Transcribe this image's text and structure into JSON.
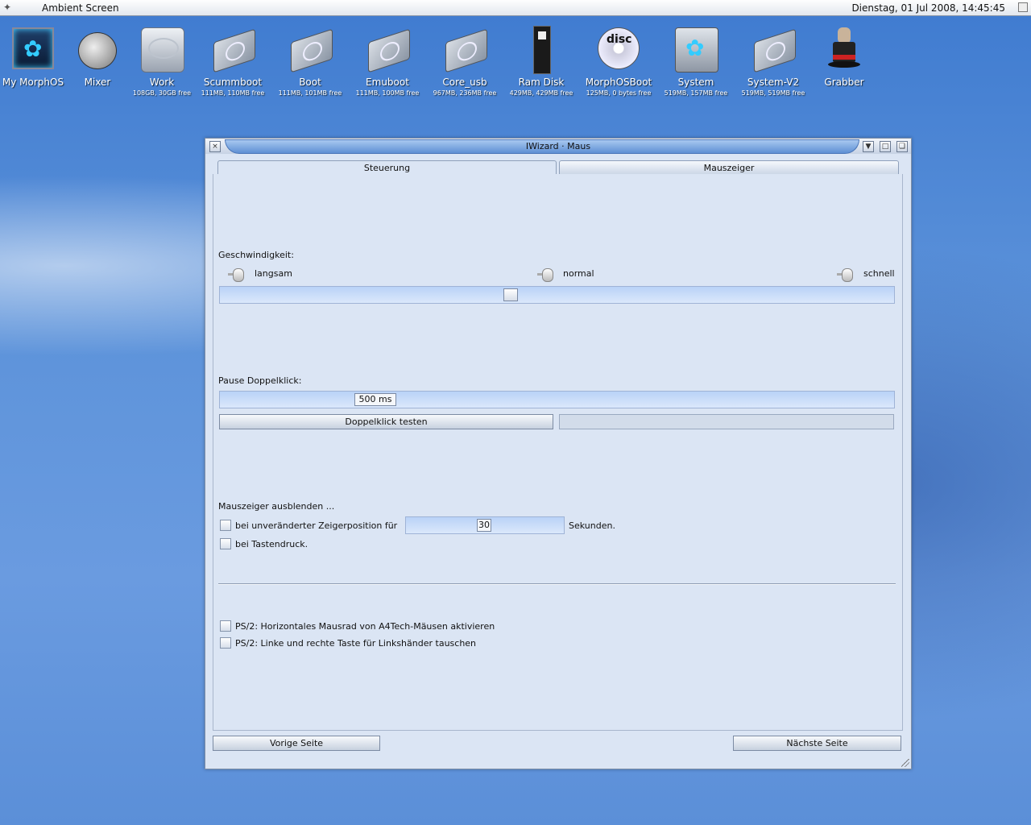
{
  "menubar": {
    "title": "Ambient Screen",
    "clock": "Dienstag, 01 Jul 2008, 14:45:45"
  },
  "desktop_icons": [
    {
      "label": "My MorphOS",
      "sub": "",
      "icon": "morphos-icon"
    },
    {
      "label": "Mixer",
      "sub": "",
      "icon": "mixer-icon"
    },
    {
      "label": "Work",
      "sub": "108GB, 30GB free",
      "icon": "harddisk-icon"
    },
    {
      "label": "Scummboot",
      "sub": "111MB, 110MB free",
      "icon": "drive-icon"
    },
    {
      "label": "Boot",
      "sub": "111MB, 101MB free",
      "icon": "drive-icon"
    },
    {
      "label": "Emuboot",
      "sub": "111MB, 100MB free",
      "icon": "drive-icon"
    },
    {
      "label": "Core_usb",
      "sub": "967MB, 236MB free",
      "icon": "drive-icon"
    },
    {
      "label": "Ram Disk",
      "sub": "429MB, 429MB free",
      "icon": "ramdisk-icon"
    },
    {
      "label": "MorphOSBoot",
      "sub": "125MB, 0 bytes free",
      "icon": "disc-icon",
      "disc_text": "disc"
    },
    {
      "label": "System",
      "sub": "519MB, 157MB free",
      "icon": "system-icon"
    },
    {
      "label": "System-V2",
      "sub": "519MB, 519MB free",
      "icon": "drive-icon"
    },
    {
      "label": "Grabber",
      "sub": "",
      "icon": "grabber-icon"
    }
  ],
  "window": {
    "title": "IWizard · Maus",
    "tabs": [
      {
        "label": "Steuerung",
        "active": true
      },
      {
        "label": "Mauszeiger",
        "active": false
      }
    ],
    "speed": {
      "label": "Geschwindigkeit:",
      "slow": "langsam",
      "normal": "normal",
      "fast": "schnell",
      "level": 0.43
    },
    "doubleclick": {
      "label": "Pause Doppelklick:",
      "value": "500 ms",
      "test_button": "Doppelklick testen"
    },
    "hide_pointer": {
      "label": "Mauszeiger ausblenden ...",
      "opt1_label": "bei unveränderter Zeigerposition für",
      "opt1_value": "30",
      "opt1_suffix": "Sekunden.",
      "opt2_label": "bei Tastendruck."
    },
    "ps2": {
      "opt1_label": "PS/2: Horizontales Mausrad von A4Tech-Mäusen aktivieren",
      "opt2_label": "PS/2: Linke und rechte Taste für Linkshänder tauschen"
    },
    "nav": {
      "prev": "Vorige Seite",
      "next": "Nächste Seite"
    }
  }
}
